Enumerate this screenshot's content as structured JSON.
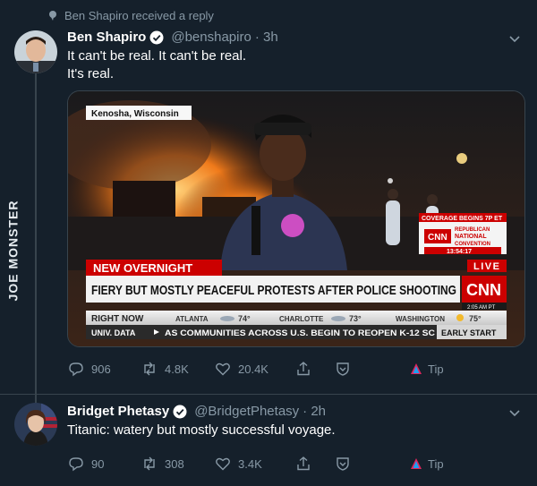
{
  "social_context": "Ben Shapiro received a reply",
  "tweets": [
    {
      "name": "Ben Shapiro",
      "handle": "@benshapiro",
      "time": "· 3h",
      "text_lines": [
        "It can't be real. It can't be real.",
        "It's real."
      ],
      "stats": {
        "replies": "906",
        "retweets": "4.8K",
        "likes": "20.4K"
      },
      "tip_label": "Tip"
    },
    {
      "name": "Bridget Phetasy",
      "handle": "@BridgetPhetasy",
      "time": "· 2h",
      "text_lines": [
        "Titanic: watery but mostly successful voyage."
      ],
      "stats": {
        "replies": "90",
        "retweets": "308",
        "likes": "3.4K"
      },
      "tip_label": "Tip"
    }
  ],
  "media": {
    "location_tag": "Kenosha, Wisconsin",
    "banner_kicker": "NEW OVERNIGHT",
    "headline": "FIERY BUT MOSTLY PEACEFUL PROTESTS AFTER POLICE SHOOTING",
    "network": "CNN",
    "live_label": "LIVE",
    "live_time": "2:05 AM PT",
    "coverage_promo": "COVERAGE BEGINS 7P ET",
    "promo_title": [
      "REPUBLICAN",
      "NATIONAL",
      "CONVENTION"
    ],
    "promo_clock": "13:54:17",
    "right_now_label": "RIGHT NOW",
    "weather": [
      {
        "city": "ATLANTA",
        "temp": "74°"
      },
      {
        "city": "CHARLOTTE",
        "temp": "73°"
      },
      {
        "city": "WASHINGTON",
        "temp": "75°"
      }
    ],
    "ticker_label": "UNIV. DATA",
    "ticker_text": "AS COMMUNITIES ACROSS U.S. BEGIN TO REOPEN K-12 SC",
    "ticker_tail": "EARLY START"
  },
  "watermark": "JOE MONSTER",
  "colors": {
    "bg": "#15202b",
    "muted": "#8899a6",
    "accent": "#1da1f2",
    "cnn_red": "#cc0000"
  }
}
